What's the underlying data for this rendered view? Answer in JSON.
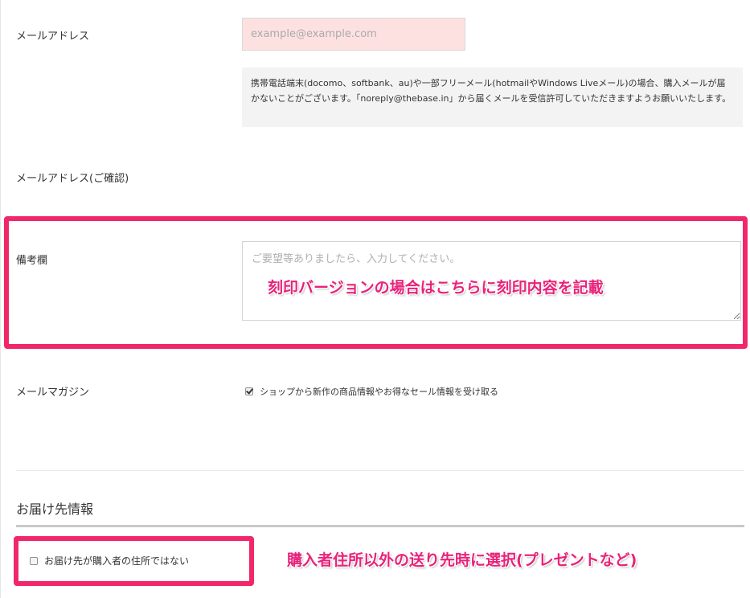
{
  "form": {
    "email": {
      "label": "メールアドレス",
      "placeholder": "example@example.com",
      "notice": "携帯電話端末(docomo、softbank、au)や一部フリーメール(hotmailやWindows Liveメール)の場合、購入メールが届かないことがございます。「noreply@thebase.in」から届くメールを受信許可していただきますようお願いいたします。"
    },
    "email_confirm": {
      "label": "メールアドレス(ご確認)"
    },
    "remarks": {
      "label": "備考欄",
      "placeholder": "ご要望等ありましたら、入力してください。"
    },
    "newsletter": {
      "label": "メールマガジン",
      "checkbox_label": "ショップから新作の商品情報やお得なセール情報を受け取る",
      "checked": true
    }
  },
  "delivery": {
    "section_title": "お届け先情報",
    "different_address_label": "お届け先が購入者の住所ではない",
    "checked": false
  },
  "annotations": {
    "remarks_note": "刻印バージョンの場合はこちらに刻印内容を記載",
    "delivery_note": "購入者住所以外の送り先時に選択(プレゼントなど)",
    "color": "#f0286a"
  }
}
